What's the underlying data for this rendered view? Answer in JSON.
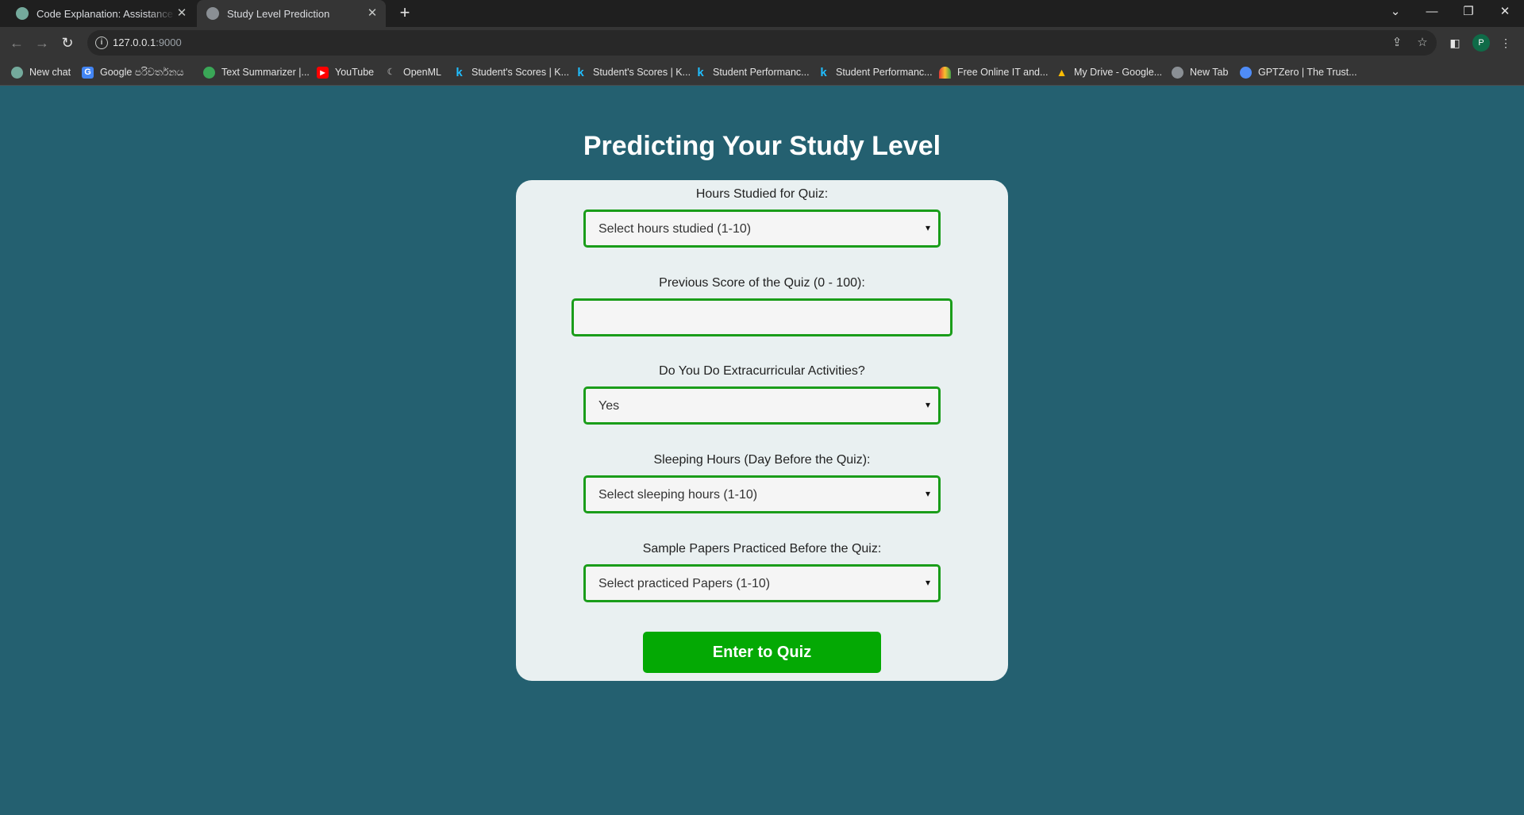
{
  "browser": {
    "tabs": [
      {
        "title": "Code Explanation: Assistance Pro",
        "favicon": "chatgpt-icon"
      },
      {
        "title": "Study Level Prediction",
        "favicon": "globe-icon"
      }
    ],
    "url_prefix": "127.0.0.1",
    "url_suffix": ":9000",
    "profile_initial": "P",
    "bookmarks": [
      "New chat",
      "Google පරිවර්තනය",
      "Text Summarizer |...",
      "YouTube",
      "OpenML",
      "Student's Scores | K...",
      "Student's Scores | K...",
      "Student Performanc...",
      "Student Performanc...",
      "Free Online IT and...",
      "My Drive - Google...",
      "New Tab",
      "GPTZero | The Trust..."
    ]
  },
  "page": {
    "title": "Predicting Your Study Level",
    "form": {
      "hours_label": "Hours Studied for Quiz:",
      "hours_value": "Select hours studied (1-10)",
      "score_label": "Previous Score of the Quiz (0 - 100):",
      "score_value": "",
      "extra_label": "Do You Do Extracurricular Activities?",
      "extra_value": "Yes",
      "sleep_label": "Sleeping Hours (Day Before the Quiz):",
      "sleep_value": "Select sleeping hours (1-10)",
      "papers_label": "Sample Papers Practiced Before the Quiz:",
      "papers_value": "Select practiced Papers (1-10)",
      "submit_label": "Enter to Quiz"
    }
  },
  "colors": {
    "page_bg": "#246070",
    "card_bg": "#e9f0f1",
    "accent_green": "#04a904",
    "field_border": "#1a9d1a"
  }
}
